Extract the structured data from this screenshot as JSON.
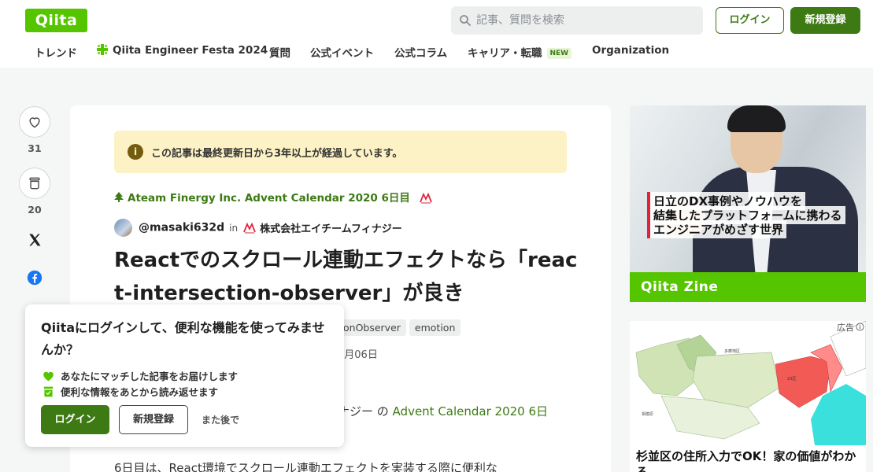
{
  "header": {
    "logo": "Qiita",
    "search_placeholder": "記事、質問を検索",
    "login_label": "ログイン",
    "signup_label": "新規登録"
  },
  "nav": {
    "items": [
      "トレンド",
      "Qiita Engineer Festa 2024",
      "質問",
      "公式イベント",
      "公式コラム",
      "キャリア・転職",
      "Organization"
    ],
    "new_badge": "NEW"
  },
  "side_actions": {
    "like_count": "31",
    "stock_count": "20"
  },
  "article": {
    "notice": "この記事は最終更新日から3年以上が経過しています。",
    "calendar": "Ateam Finergy Inc. Advent Calendar 2020 6日目",
    "author": "@masaki632d",
    "in_label": "in",
    "organization": "株式会社エイチームフィナジー",
    "title": "Reactでのスクロール連動エフェクトなら「react-intersection-observer」が良き",
    "tags": [
      "onObserver",
      "emotion"
    ],
    "date": "2月06日",
    "body_prefix": "ナジー の ",
    "body_link": "Advent Calendar 2020 6日",
    "body_line2": "6日目は、React環境でスクロール連動エフェクトを実装する際に便利な"
  },
  "popup": {
    "title": "Qiitaにログインして、便利な機能を使ってみませんか？",
    "feature1": "あなたにマッチした記事をお届けします",
    "feature2": "便利な情報をあとから読み返せます",
    "login_label": "ログイン",
    "signup_label": "新規登録",
    "later_label": "また後で"
  },
  "ad1": {
    "caption_line1": "日立のDX事例やノウハウを",
    "caption_line2": "結集したプラットフォームに携わる",
    "caption_line3": "エンジニアがめざす世界",
    "brand": "Qiita Zine"
  },
  "ad2": {
    "label": "広告",
    "caption": "杉並区の住所入力でOK！家の価値がわかる"
  },
  "colors": {
    "brand_green": "#55c500",
    "dark_green": "#3d7a14",
    "notice_bg": "#fdf2c5"
  }
}
